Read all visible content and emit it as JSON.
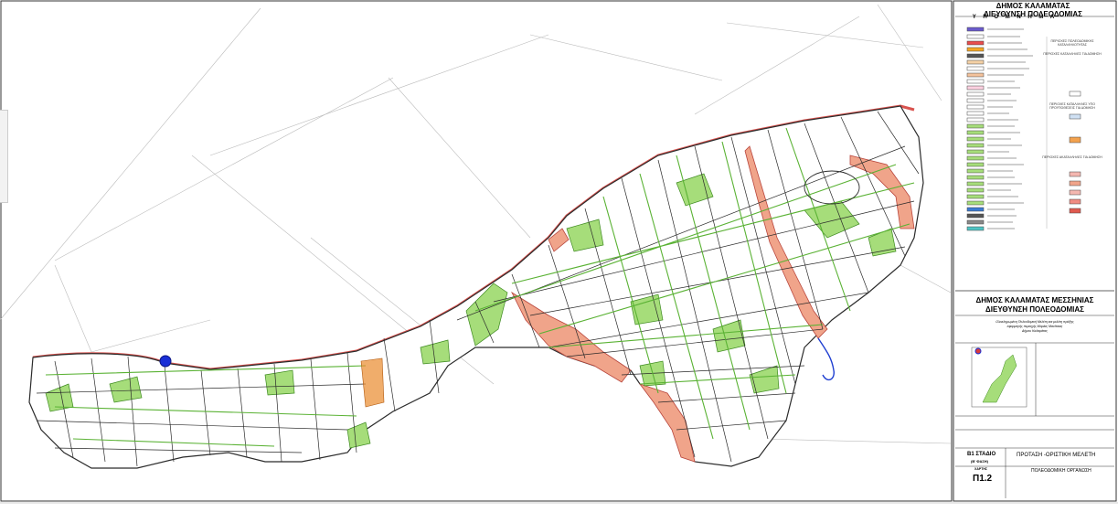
{
  "legend_panel": {
    "title_line1": "ΔΗΜΟΣ ΚΑΛΑΜΑΤΑΣ",
    "title_line2": "ΔΙΕΥΘΥΝΣΗ ΠΟΛΕΟΔΟΜΙΑΣ",
    "legend_heading": "Υ Π Ο Μ Ν Η Μ Α",
    "right_group_1": "ΠΕΡΙΟΧΕΣ ΠΟΛΕΟΔΟΜΙΚΗΣ ΚΑΤΑΛΛΗΛΟΤΗΤΑΣ",
    "right_group_2": "ΠΕΡΙΟΧΕΣ ΚΑΤΑΛΛΗΛΕΣ ΓΙΑ ΔΟΜΗΣΗ",
    "right_group_3": "ΠΕΡΙΟΧΕΣ ΚΑΤΑΛΛΗΛΕΣ ΥΠΟ ΠΡΟΫΠΟΘΕΣΕΙΣ ΓΙΑ ΔΟΜΗΣΗ",
    "right_group_4": "ΠΕΡΙΟΧΕΣ ΑΚΑΤΑΛΛΗΛΕΣ ΓΙΑ ΔΟΜΗΣΗ"
  },
  "title_block": {
    "title_line1": "ΔΗΜΟΣ ΚΑΛΑΜΑΤΑΣ ΜΕΣΣΗΝΙΑΣ",
    "title_line2": "ΔΙΕΥΘΥΝΣΗ ΠΟΛΕΟΔΟΜΙΑΣ",
    "description_1": "Ολοκληρωμένη Πολεοδομική Μελέτη και μελέτη πράξης",
    "description_2": "εφαρμογής περιοχής Μαρίας Μανίτσιας",
    "description_3": "Δήμου Καλαμάτας",
    "stage": "Β1 ΣΤΑΔΙΟ",
    "stage_sub": "(Β' ΦΑΣΗ)",
    "proposal": "ΠΡΟΤΑΣΗ -ΟΡΙΣΤΙΚΗ ΜΕΛΕΤΗ",
    "subject": "ΠΟΛΕΟΔΟΜΙΚΗ ΟΡΓΑΝΩΣΗ",
    "sheet_label": "ΧΑΡΤΗΣ",
    "sheet_number": "Π1.2"
  },
  "colors": {
    "block_green": "#5ab234",
    "park_green": "#a6dd7a",
    "coast_red": "#d9534f",
    "salmon": "#f0a48a",
    "orange": "#e98a2c",
    "blue_marker": "#1a2fd6",
    "river_blue": "#1f3fd1"
  }
}
